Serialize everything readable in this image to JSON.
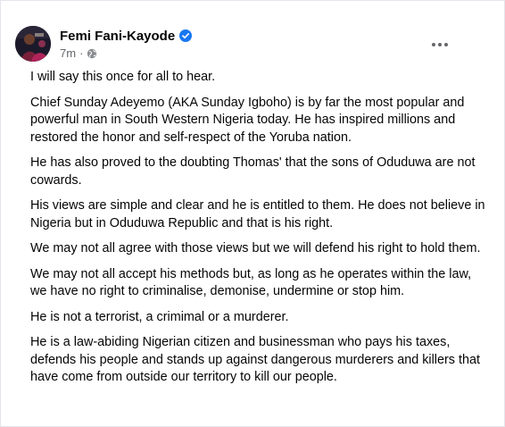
{
  "post": {
    "author": {
      "name": "Femi Fani-Kayode",
      "verified": true,
      "verified_badge_color": "#1877f2",
      "avatar_icon": "profile-photo"
    },
    "timestamp": "7m",
    "separator": "·",
    "audience_icon": "globe-icon",
    "more_icon": "more-horizontal-icon",
    "paragraphs": [
      "I will say this once for all to hear.",
      "Chief Sunday Adeyemo (AKA Sunday Igboho) is by far the most popular and powerful man in South Western Nigeria today. He has inspired millions and restored the honor and self-respect of the Yoruba nation.",
      "He has also proved to the doubting Thomas' that the sons of Oduduwa are not cowards.",
      "His views are simple and clear and he is entitled to them. He does not believe in Nigeria but in Oduduwa Republic and that is his right.",
      "We may not all agree with those views but we will defend his right to hold them.",
      "We may not all accept his methods but, as long as he operates within the law, we have no right to criminalise, demonise, undermine or stop him.",
      "He is not a terrorist, a crimimal or a murderer.",
      "He is a law-abiding Nigerian citizen and businessman who pays his taxes, defends his people and stands up against  dangerous murderers and killers that have come from outside our territory to kill our people."
    ]
  },
  "colors": {
    "text": "#050505",
    "secondary_text": "#65676b",
    "background": "#ffffff",
    "accent": "#1877f2"
  }
}
